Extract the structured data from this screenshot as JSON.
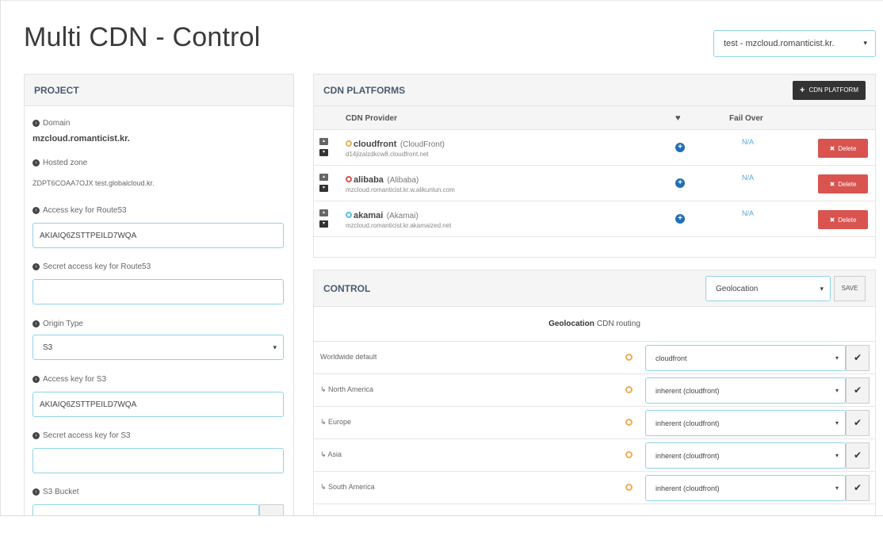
{
  "app": {
    "title": "Multi CDN - Control",
    "project_select": "test - mzcloud.romanticist.kr."
  },
  "project": {
    "heading": "PROJECT",
    "domain_label": "Domain",
    "domain_value": "mzcloud.romanticist.kr.",
    "zone_label": "Hosted zone",
    "zone_value": "ZDPT6COAA7OJX test.globalcloud.kr.",
    "route53_key_label": "Access key for Route53",
    "route53_key_value": "AKIAIQ6ZSTTPEILD7WQA",
    "route53_secret_label": "Secret access key for Route53",
    "route53_secret_value": "",
    "origin_label": "Origin Type",
    "origin_value": "S3",
    "s3_key_label": "Access key for S3",
    "s3_key_value": "AKIAIQ6ZSTTPEILD7WQA",
    "s3_secret_label": "Secret access key for S3",
    "s3_secret_value": "",
    "bucket_label": "S3 Bucket"
  },
  "cdn": {
    "heading": "CDN PLATFORMS",
    "add_label": "CDN PLATFORM",
    "col_provider": "CDN Provider",
    "col_health": "♥",
    "col_failover": "Fail Over",
    "delete_label": "Delete",
    "rows": [
      {
        "name": "cloudfront",
        "type": "(CloudFront)",
        "domain": "d14jizalzdkcw8.cloudfront.net",
        "failover": "N/A",
        "dot_color": "#f0ad4e"
      },
      {
        "name": "alibaba",
        "type": "(Alibaba)",
        "domain": "mzcloud.romanticist.kr.w.alikunlun.com",
        "failover": "N/A",
        "dot_color": "#d9534f"
      },
      {
        "name": "akamai",
        "type": "(Akamai)",
        "domain": "mzcloud.romanticist.kr.akamaized.net",
        "failover": "N/A",
        "dot_color": "#5bc0de"
      }
    ]
  },
  "control": {
    "heading": "CONTROL",
    "mode": "Geolocation",
    "save_label": "SAVE",
    "routing_bold": "Geolocation",
    "routing_rest": "CDN routing",
    "routes": [
      {
        "name": "Worldwide default",
        "value": "cloudfront"
      },
      {
        "name": "↳ North America",
        "value": "inherent (cloudfront)"
      },
      {
        "name": "↳ Europe",
        "value": "inherent (cloudfront)"
      },
      {
        "name": "↳ Asia",
        "value": "inherent (cloudfront)"
      },
      {
        "name": "↳ South America",
        "value": "inherent (cloudfront)"
      }
    ]
  }
}
